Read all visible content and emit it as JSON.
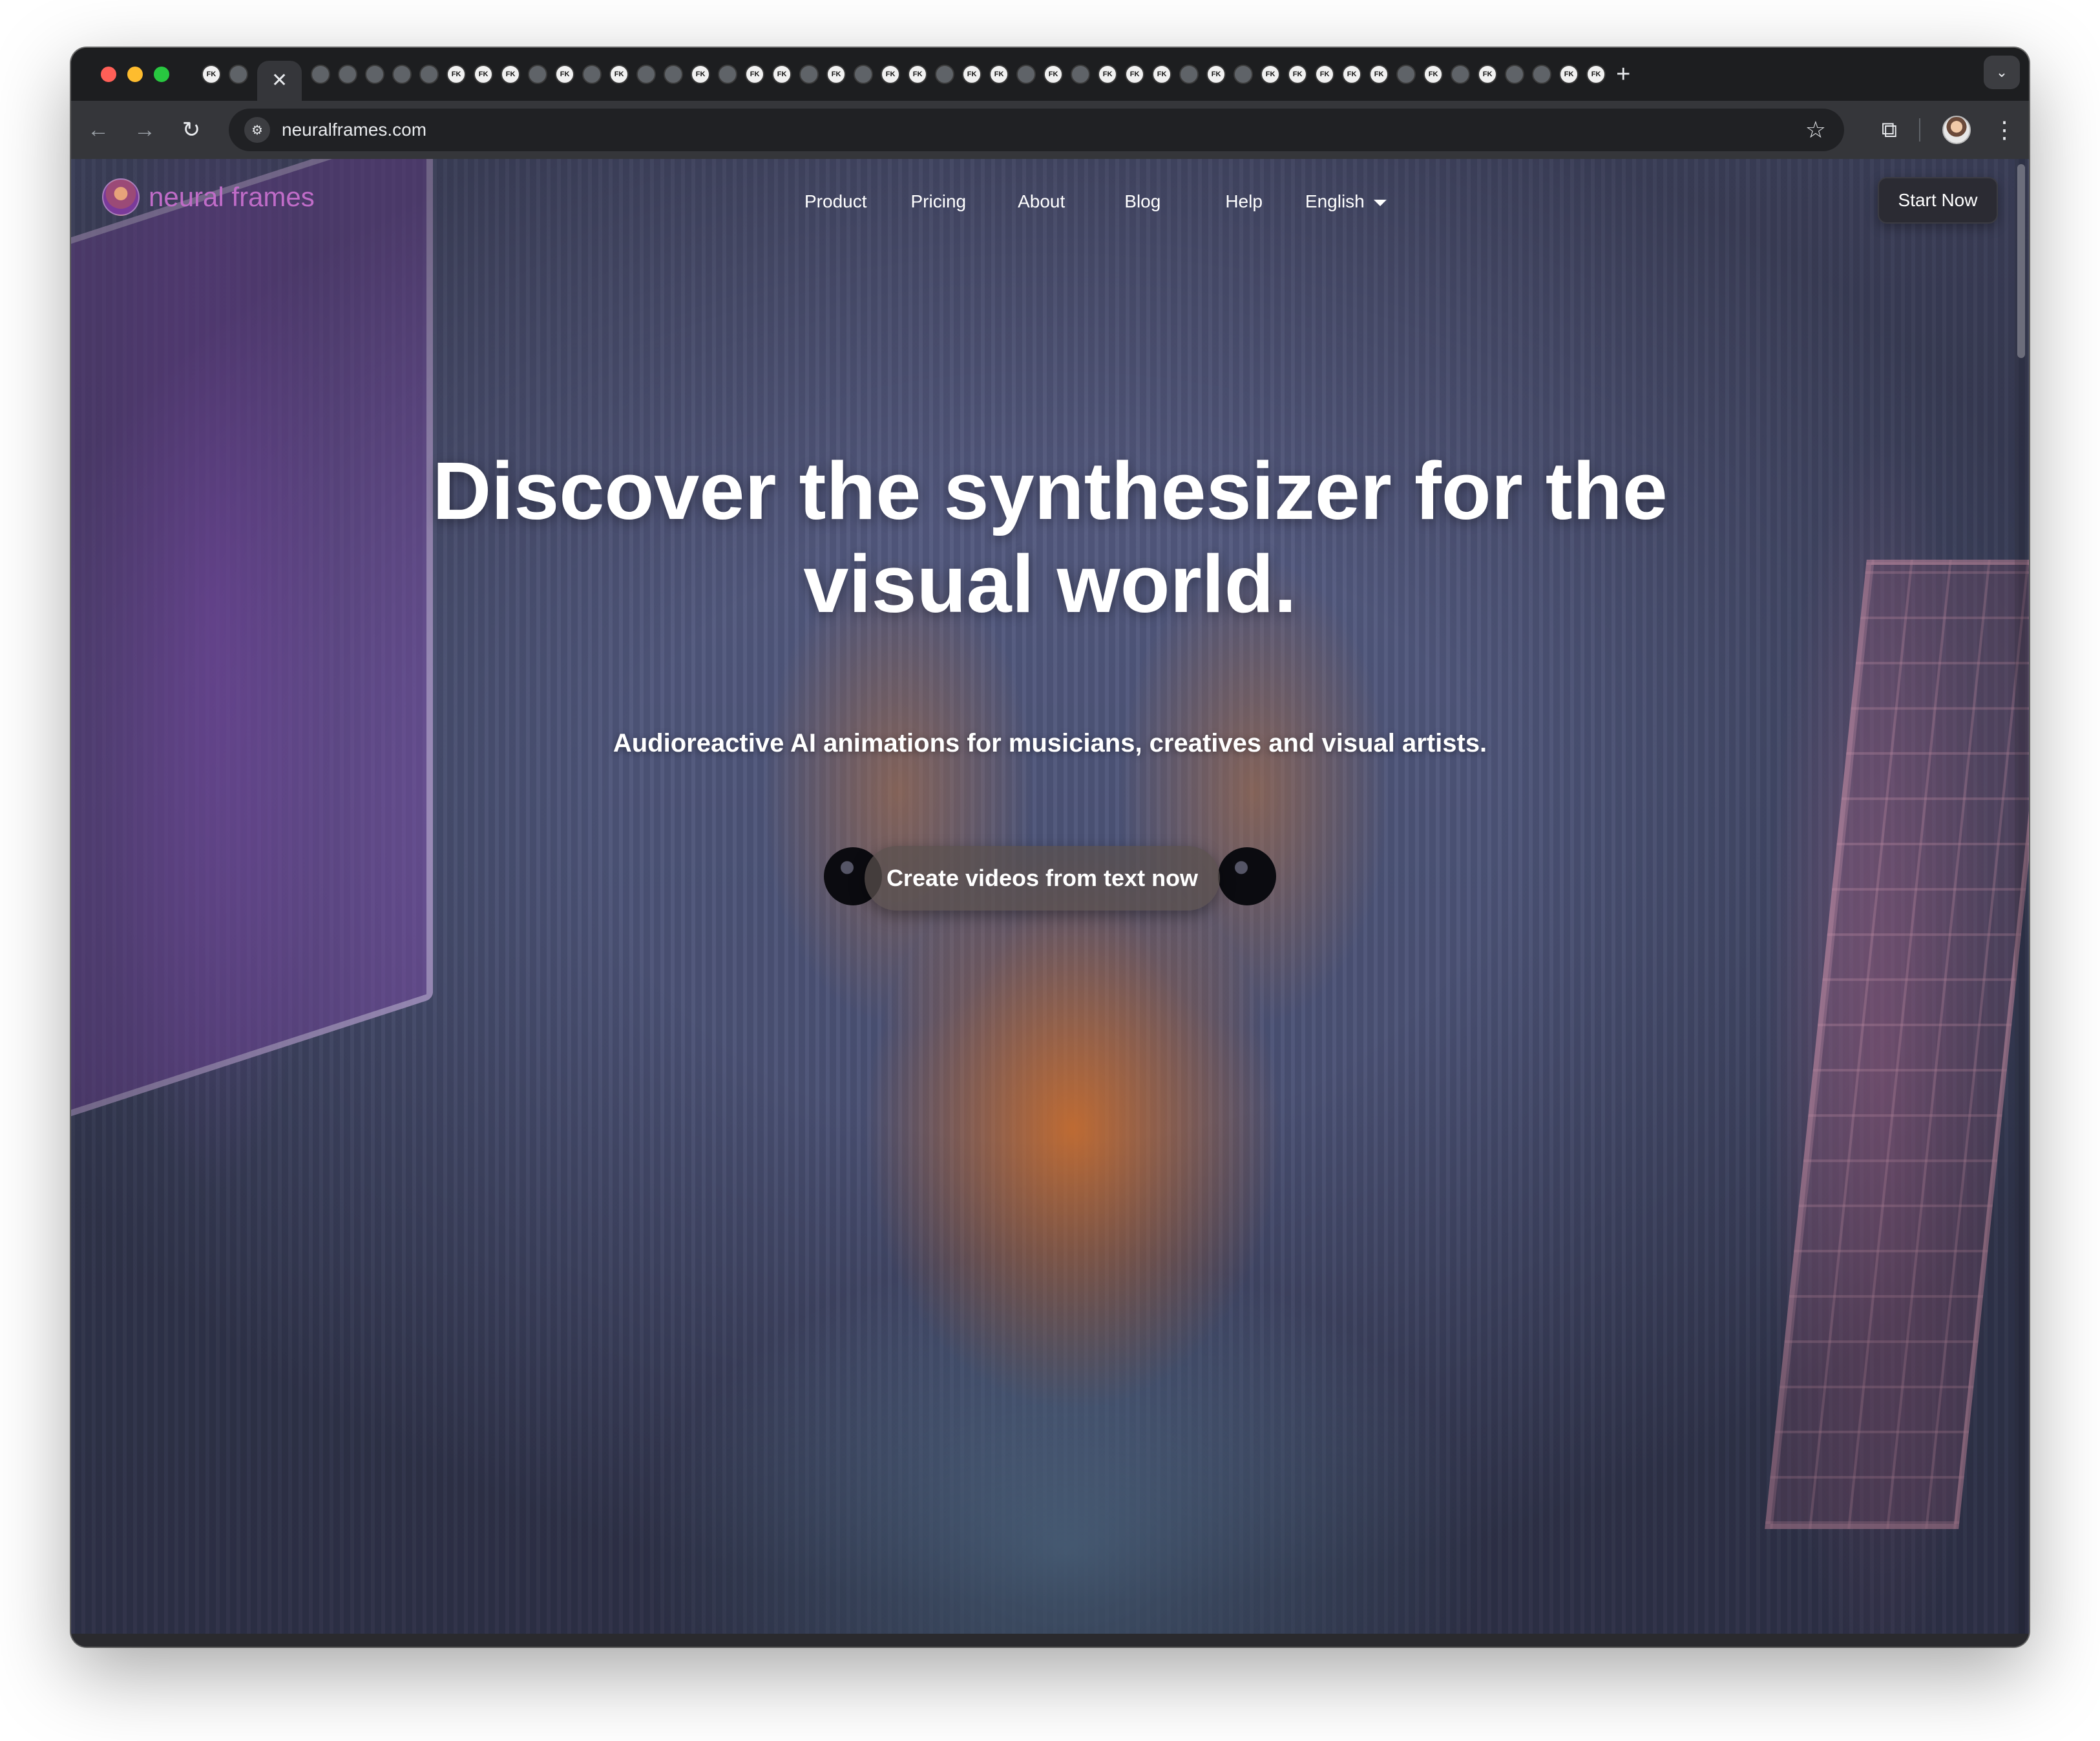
{
  "browser": {
    "window_controls": [
      "close",
      "minimize",
      "zoom"
    ],
    "tabs": {
      "favicon_labels": [
        "FK",
        "FK",
        "FK",
        "FK",
        "FK",
        "FK",
        "FK",
        "FK",
        "FK",
        "FK",
        "FK",
        "FK",
        "FK",
        "FK",
        "FK",
        "FK",
        "FK",
        "FK",
        "FK",
        "FK",
        "FK",
        "FK",
        "FK",
        "FK",
        "FK",
        "FK",
        "FK",
        "FK",
        "FK",
        "FK",
        "FK",
        "FK",
        "FK",
        "FK",
        "FK",
        "FK",
        "FK",
        "FK",
        "FK",
        "FK",
        "FK",
        "FK",
        "FK",
        "FK",
        "FK",
        "FK",
        "FK",
        "FK",
        "FK",
        "FK",
        "FK",
        "FK",
        "FK",
        "FK",
        "FK"
      ],
      "close_glyph": "✕",
      "new_tab_glyph": "+",
      "dropdown_glyph": "⌄"
    },
    "toolbar": {
      "back_glyph": "←",
      "forward_glyph": "→",
      "reload_glyph": "↻",
      "site_info_glyph": "⚙",
      "url": "neuralframes.com",
      "bookmark_glyph": "☆",
      "extensions_glyph": "⧉",
      "menu_glyph": "⋮"
    }
  },
  "site": {
    "logo_text": "neural frames",
    "nav": {
      "product": "Product",
      "pricing": "Pricing",
      "about": "About",
      "blog": "Blog",
      "help": "Help",
      "language": "English"
    },
    "start_now": "Start Now",
    "hero": {
      "headline_line1": "Discover the synthesizer for the",
      "headline_line2": "visual world.",
      "subheadline": "Audioreactive AI animations for musicians, creatives and visual artists.",
      "cta": "Create videos from text now"
    }
  },
  "colors": {
    "browser_chrome": "#35363a",
    "tabstrip": "#1d1e20",
    "logo_text": "#c06cc8",
    "hero_text": "#ffffff",
    "start_now_bg": "#2b2b33"
  }
}
